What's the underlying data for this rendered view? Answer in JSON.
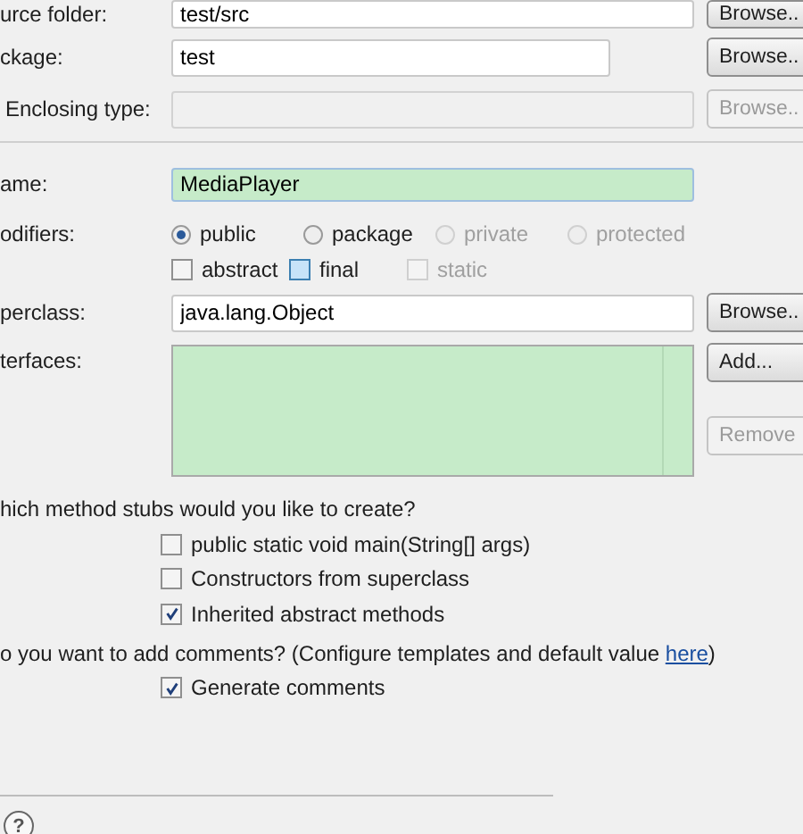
{
  "source_folder": {
    "label": "urce folder:",
    "value": "test/src",
    "button": {
      "label": "Browse..",
      "disabled": false
    }
  },
  "package": {
    "label": "ckage:",
    "value": "test",
    "button": {
      "label": "Browse..",
      "disabled": false
    }
  },
  "enclosing_type": {
    "label": "Enclosing type:",
    "disabled": true,
    "button": {
      "label": "Browse..",
      "disabled": true
    }
  },
  "name": {
    "label": "ame:",
    "value": "MediaPlayer"
  },
  "modifiers": {
    "label": "odifiers:",
    "access": [
      {
        "label": "public",
        "selected": true,
        "disabled": false
      },
      {
        "label": "package",
        "selected": false,
        "disabled": false
      },
      {
        "label": "private",
        "selected": false,
        "disabled": true
      },
      {
        "label": "protected",
        "selected": false,
        "disabled": true
      }
    ],
    "flags": [
      {
        "label": "abstract",
        "checked": false,
        "disabled": false,
        "highlighted": false
      },
      {
        "label": "final",
        "checked": false,
        "disabled": false,
        "highlighted": true
      },
      {
        "label": "static",
        "checked": false,
        "disabled": true,
        "highlighted": false
      }
    ]
  },
  "superclass": {
    "label": "perclass:",
    "value": "java.lang.Object",
    "button": {
      "label": "Browse..",
      "disabled": false
    }
  },
  "interfaces": {
    "label": "terfaces:",
    "buttons": [
      {
        "label": "Add...",
        "disabled": false
      },
      {
        "label": "Remove",
        "disabled": true
      }
    ]
  },
  "method_stubs": {
    "question": "hich method stubs would you like to create?",
    "options": [
      {
        "label": "public static void main(String[] args)",
        "checked": false
      },
      {
        "label": "Constructors from superclass",
        "checked": false
      },
      {
        "label": "Inherited abstract methods",
        "checked": true
      }
    ]
  },
  "comments": {
    "question": "o you want to add comments? (Configure templates and default value",
    "link": "here",
    "closing": ")",
    "options": [
      {
        "label": "Generate comments",
        "checked": true
      }
    ]
  },
  "help": {
    "label": "?"
  }
}
